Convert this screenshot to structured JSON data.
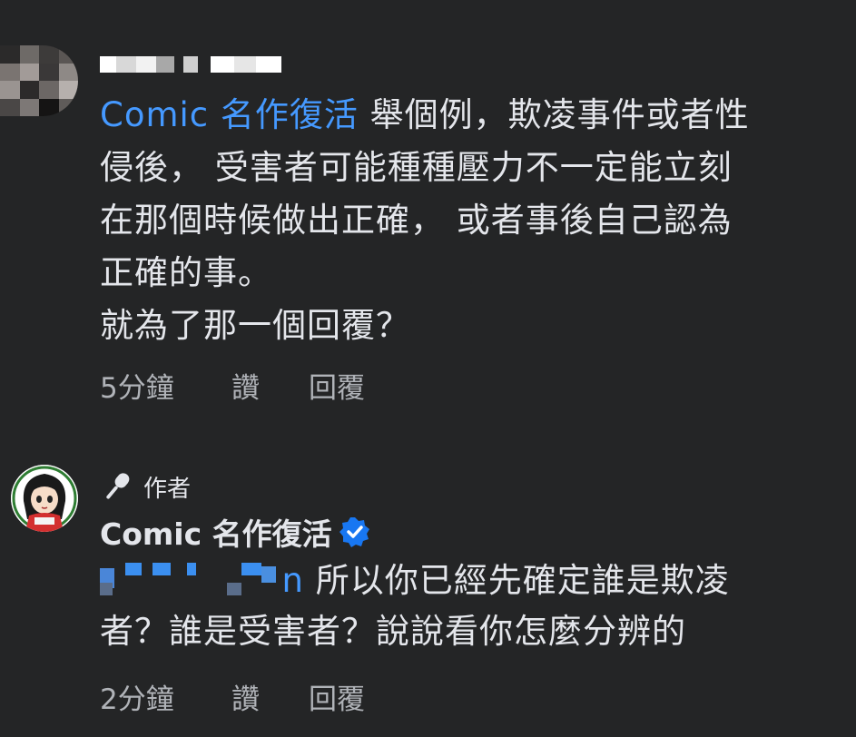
{
  "comment1": {
    "mention": "Comic 名作復活",
    "text_lines": [
      " 舉個例，欺凌事件或者性",
      "侵後， 受害者可能種種壓力不一定能立刻",
      "在那個時候做出正確， 或者事後自己認為",
      "正確的事。",
      "就為了那一個回覆？"
    ],
    "time": "5分鐘",
    "like": "讚",
    "reply": "回覆"
  },
  "comment2": {
    "badge": "作者",
    "author": "Comic 名作復活",
    "mention_tail": "n",
    "text_first": " 所以你已經先確定誰是欺凌",
    "text_second": "者？誰是受害者？說說看你怎麼分辨的",
    "time": "2分鐘",
    "like": "讚",
    "reply": "回覆"
  },
  "colors": {
    "background": "#242526",
    "text": "#e4e6eb",
    "secondary": "#b0b3b8",
    "mention": "#4599ff",
    "verified": "#1877f2"
  },
  "icons": [
    "microphone-icon",
    "verified-badge-icon"
  ]
}
